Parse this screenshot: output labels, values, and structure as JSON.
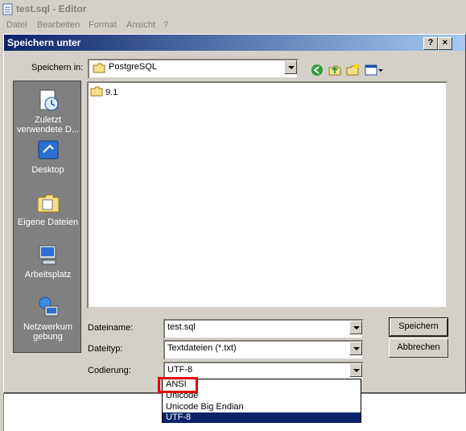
{
  "editor": {
    "title": "test.sql - Editor",
    "menu": [
      "Datei",
      "Bearbeiten",
      "Format",
      "Ansicht",
      "?"
    ]
  },
  "dialog": {
    "title": "Speichern unter",
    "help_btn": "?",
    "close_btn": "×",
    "save_in_label": "Speichern in:",
    "save_in_value": "PostgreSQL",
    "places": [
      "Zuletzt verwendete D...",
      "Desktop",
      "Eigene Dateien",
      "Arbeitsplatz",
      "Netzwerkumgebung"
    ],
    "folder_item": "9.1",
    "filename_label": "Dateiname:",
    "filename_value": "test.sql",
    "filetype_label": "Dateityp:",
    "filetype_value": "Textdateien (*.txt)",
    "encoding_label": "Codierung:",
    "encoding_value": "UTF-8",
    "encoding_options": [
      "ANSI",
      "Unicode",
      "Unicode Big Endian",
      "UTF-8"
    ],
    "save_button": "Speichern",
    "cancel_button": "Abbrechen"
  },
  "colors": {
    "dialog_bg": "#d4d0c8",
    "title_active": "#0a246a",
    "highlight": "#e00000"
  }
}
